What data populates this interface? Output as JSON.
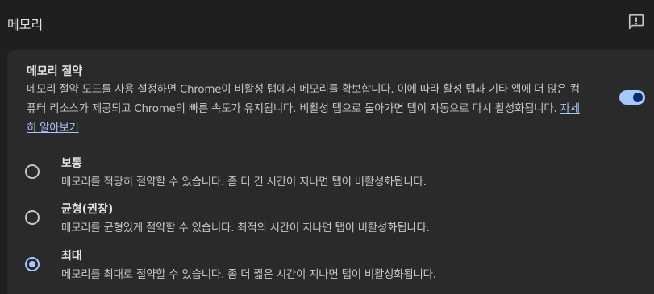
{
  "page": {
    "title": "메모리"
  },
  "memory_saver": {
    "title": "메모리 절약",
    "description": "메모리 절약 모드를 사용 설정하면 Chrome이 비활성 탭에서 메모리를 확보합니다. 이에 따라 활성 탭과 기타 앱에 더 많은 컴퓨터 리소스가 제공되고 Chrome의 빠른 속도가 유지됩니다. 비활성 탭으로 돌아가면 탭이 자동으로 다시 활성화됩니다.",
    "learn_more": "자세히 알아보기",
    "enabled": true,
    "accent_color": "#a8c7fa",
    "options": [
      {
        "label": "보통",
        "description": "메모리를 적당히 절약할 수 있습니다. 좀 더 긴 시간이 지나면 탭이 비활성화됩니다.",
        "selected": false
      },
      {
        "label": "균형(권장)",
        "description": "메모리를 균형있게 절약할 수 있습니다. 최적의 시간이 지나면 탭이 비활성화됩니다.",
        "selected": false
      },
      {
        "label": "최대",
        "description": "메모리를 최대로 절약할 수 있습니다. 좀 더 짧은 시간이 지나면 탭이 비활성화됩니다.",
        "selected": true
      }
    ]
  },
  "icons": {
    "feedback": "feedback-icon"
  }
}
